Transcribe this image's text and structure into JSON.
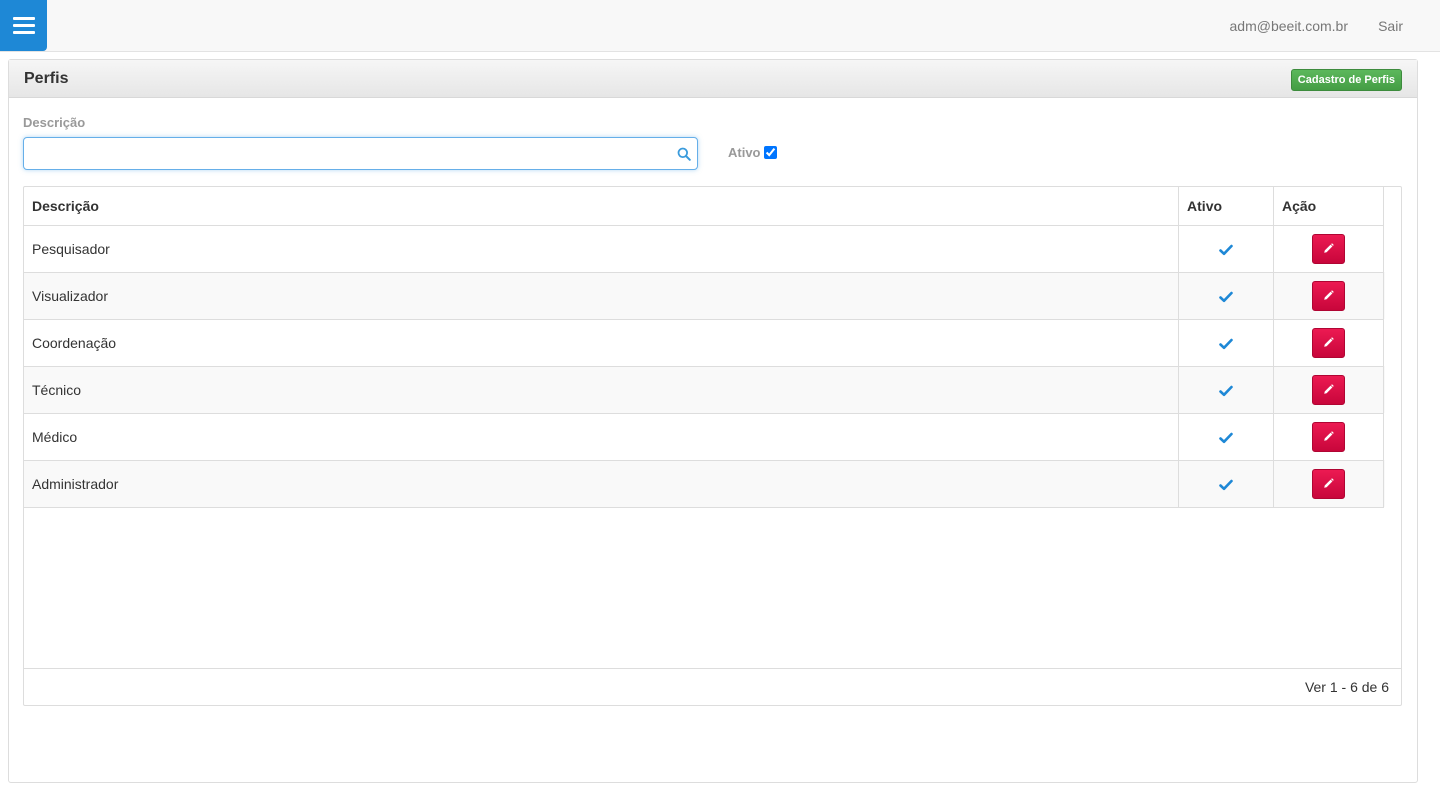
{
  "header": {
    "user_email": "adm@beeit.com.br",
    "logout_label": "Sair",
    "menu_icon": "hamburger-menu-icon"
  },
  "panel": {
    "title": "Perfis",
    "new_button_label": "Cadastro de Perfis"
  },
  "filters": {
    "description_label": "Descrição",
    "description_value": "",
    "description_placeholder": "",
    "active_label": "Ativo",
    "active_checked": true
  },
  "table": {
    "columns": [
      "Descrição",
      "Ativo",
      "Ação"
    ],
    "rows": [
      {
        "descricao": "Pesquisador",
        "ativo": true
      },
      {
        "descricao": "Visualizador",
        "ativo": true
      },
      {
        "descricao": "Coordenação",
        "ativo": true
      },
      {
        "descricao": "Técnico",
        "ativo": true
      },
      {
        "descricao": "Médico",
        "ativo": true
      },
      {
        "descricao": "Administrador",
        "ativo": true
      }
    ],
    "pager_info": "Ver 1 - 6 de 6"
  },
  "colors": {
    "menu_blue": "#1e88d6",
    "success_green": "#5cb85c",
    "edit_red": "#e0104a",
    "check_blue": "#1e88d6"
  }
}
